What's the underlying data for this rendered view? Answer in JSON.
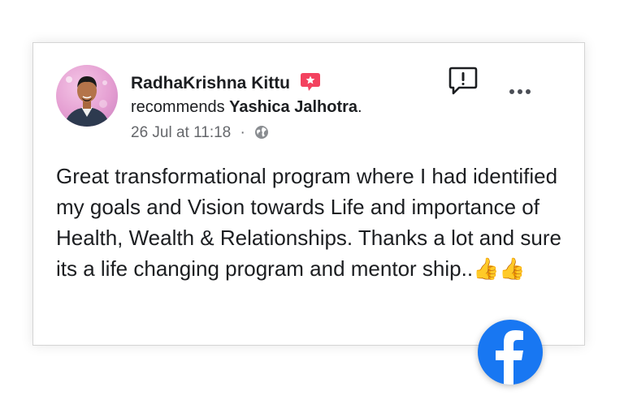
{
  "post": {
    "author_name": "RadhaKrishna Kittu",
    "recommends_prefix": "recommends",
    "recommended_page": "Yashica Jalhotra",
    "recommended_suffix": ".",
    "date": "26 Jul at 11:18",
    "separator": "·",
    "privacy_icon": "globe-icon",
    "body": "Great transformational program where I had identified my goals and Vision towards Life and importance of Health, Wealth & Relationships. Thanks a lot and sure its a life changing program and mentor ship..",
    "emoji": "👍👍"
  },
  "icons": {
    "badge": "recommendation-badge-icon",
    "report": "report-icon",
    "more": "more-options-icon",
    "brand": "facebook-logo-icon"
  },
  "colors": {
    "brand_blue": "#1877f2",
    "badge_red": "#f3425f",
    "text_primary": "#1c1e21",
    "text_secondary": "#65676b"
  }
}
